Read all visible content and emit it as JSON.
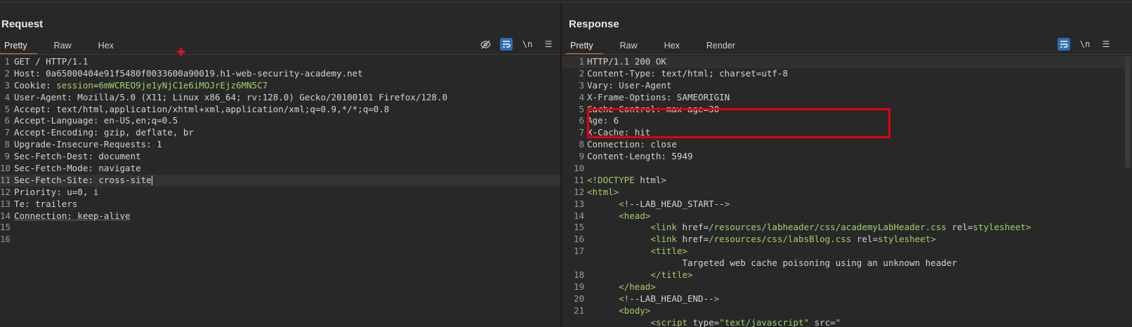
{
  "layout_buttons": [
    "▮▮",
    "☰",
    "▬"
  ],
  "request": {
    "title": "Request",
    "tabs": [
      "Pretty",
      "Raw",
      "Hex"
    ],
    "toolbar": {
      "hide_icon": "eye-off-icon",
      "wrap_icon": "wrap-icon",
      "newline": "\\n",
      "menu": "☰"
    },
    "lines": [
      [
        "GET / HTTP/1.1"
      ],
      [
        "Host: 0a65000404e91f5480f0033600a90019.h1-web-security-academy.net"
      ],
      [
        "Cookie: ",
        "session",
        "=",
        "6mWCREO9je1yNjC1e6iMOJrEjz6MN5C7"
      ],
      [
        "User-Agent: Mozilla/5.0 (X11; Linux x86_64; rv:128.0) Gecko/20100101 Firefox/128.0"
      ],
      [
        "Accept: text/html,application/xhtml+xml,application/xml;q=0.9,*/*;q=0.8"
      ],
      [
        "Accept-Language: en-US,en;q=0.5"
      ],
      [
        "Accept-Encoding: gzip, deflate, br"
      ],
      [
        "Upgrade-Insecure-Requests: 1"
      ],
      [
        "Sec-Fetch-Dest: document"
      ],
      [
        "Sec-Fetch-Mode: navigate"
      ],
      [
        "Sec-Fetch-Site: cross-site"
      ],
      [
        "Priority: u=0, i"
      ],
      [
        "Te: trailers"
      ],
      [
        "Connection: keep-alive"
      ],
      [
        ""
      ],
      [
        ""
      ]
    ]
  },
  "response": {
    "title": "Response",
    "tabs": [
      "Pretty",
      "Raw",
      "Hex",
      "Render"
    ],
    "toolbar": {
      "wrap_icon": "wrap-icon",
      "newline": "\\n",
      "menu": "☰"
    },
    "lines": [
      "HTTP/1.1 200 OK",
      "Content-Type: text/html; charset=utf-8",
      "Vary: User-Agent",
      "X-Frame-Options: SAMEORIGIN",
      "Cache-Control: max-age=30",
      "Age: 6",
      "X-Cache: hit",
      "Connection: close",
      "Content-Length: 5949",
      "",
      "<!DOCTYPE html>",
      "<html>",
      "      <!--LAB_HEAD_START-->",
      "      <head>",
      "            <link href=/resources/labheader/css/academyLabHeader.css rel=stylesheet>",
      "            <link href=/resources/css/labsBlog.css rel=stylesheet>",
      "            <title>",
      "                  Targeted web cache poisoning using an unknown header",
      "            </title>",
      "      </head>",
      "      <!--LAB_HEAD_END-->",
      "      <body>",
      "            <script type=\"text/javascript\" src=\""
    ],
    "line_numbers": [
      "1",
      "2",
      "3",
      "4",
      "5",
      "6",
      "7",
      "8",
      "9",
      "10",
      "11",
      "12",
      "13",
      "14",
      "15",
      "16",
      "17",
      "",
      "18",
      "19",
      "20",
      "21"
    ]
  },
  "colors": {
    "accent": "#e5763f",
    "highlight": "#e3000f",
    "blue": "#2f6fb3"
  }
}
